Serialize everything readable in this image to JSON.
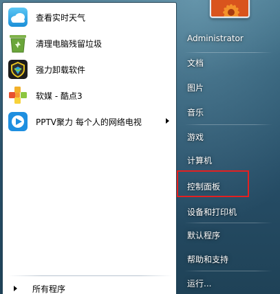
{
  "programs": [
    {
      "label": "查看实时天气",
      "icon": "weather-cloud-icon",
      "has_submenu": false
    },
    {
      "label": "清理电脑残留垃圾",
      "icon": "recycle-bin-icon",
      "has_submenu": false
    },
    {
      "label": "强力卸载软件",
      "icon": "uninstall-shield-icon",
      "has_submenu": false
    },
    {
      "label": "软媒 - 酷点3",
      "icon": "cubes-icon",
      "has_submenu": false
    },
    {
      "label": "PPTV聚力 每个人的网络电视",
      "icon": "pptv-play-icon",
      "has_submenu": true
    }
  ],
  "all_programs": {
    "label": "所有程序"
  },
  "user": {
    "picture_icon": "flower-user-picture"
  },
  "right_panel": {
    "items": [
      {
        "label": "Administrator"
      },
      {
        "label": "文档"
      },
      {
        "label": "图片"
      },
      {
        "label": "音乐"
      },
      {
        "label": "游戏"
      },
      {
        "label": "计算机"
      },
      {
        "label": "控制面板"
      },
      {
        "label": "设备和打印机"
      },
      {
        "label": "默认程序"
      },
      {
        "label": "帮助和支持"
      },
      {
        "label": "运行..."
      }
    ]
  },
  "colors": {
    "highlight_box": "#e52020",
    "menu_glass": "#2e5a73",
    "left_panel": "#ffffff"
  }
}
